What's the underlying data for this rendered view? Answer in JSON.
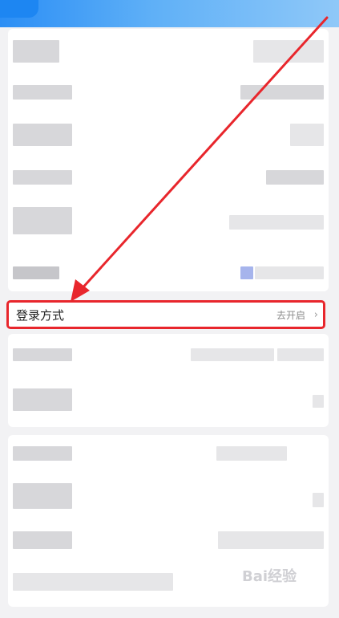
{
  "colors": {
    "header_blue": "#2b8ef5",
    "highlight_red": "#e8262c",
    "arrow_red": "#e8262c",
    "background": "#f2f2f4"
  },
  "settings": {
    "highlighted_row": {
      "label": "登录方式",
      "action": "去开启",
      "chevron_icon": "chevron-right-icon"
    }
  },
  "watermark": {
    "text": "Bai经验"
  }
}
